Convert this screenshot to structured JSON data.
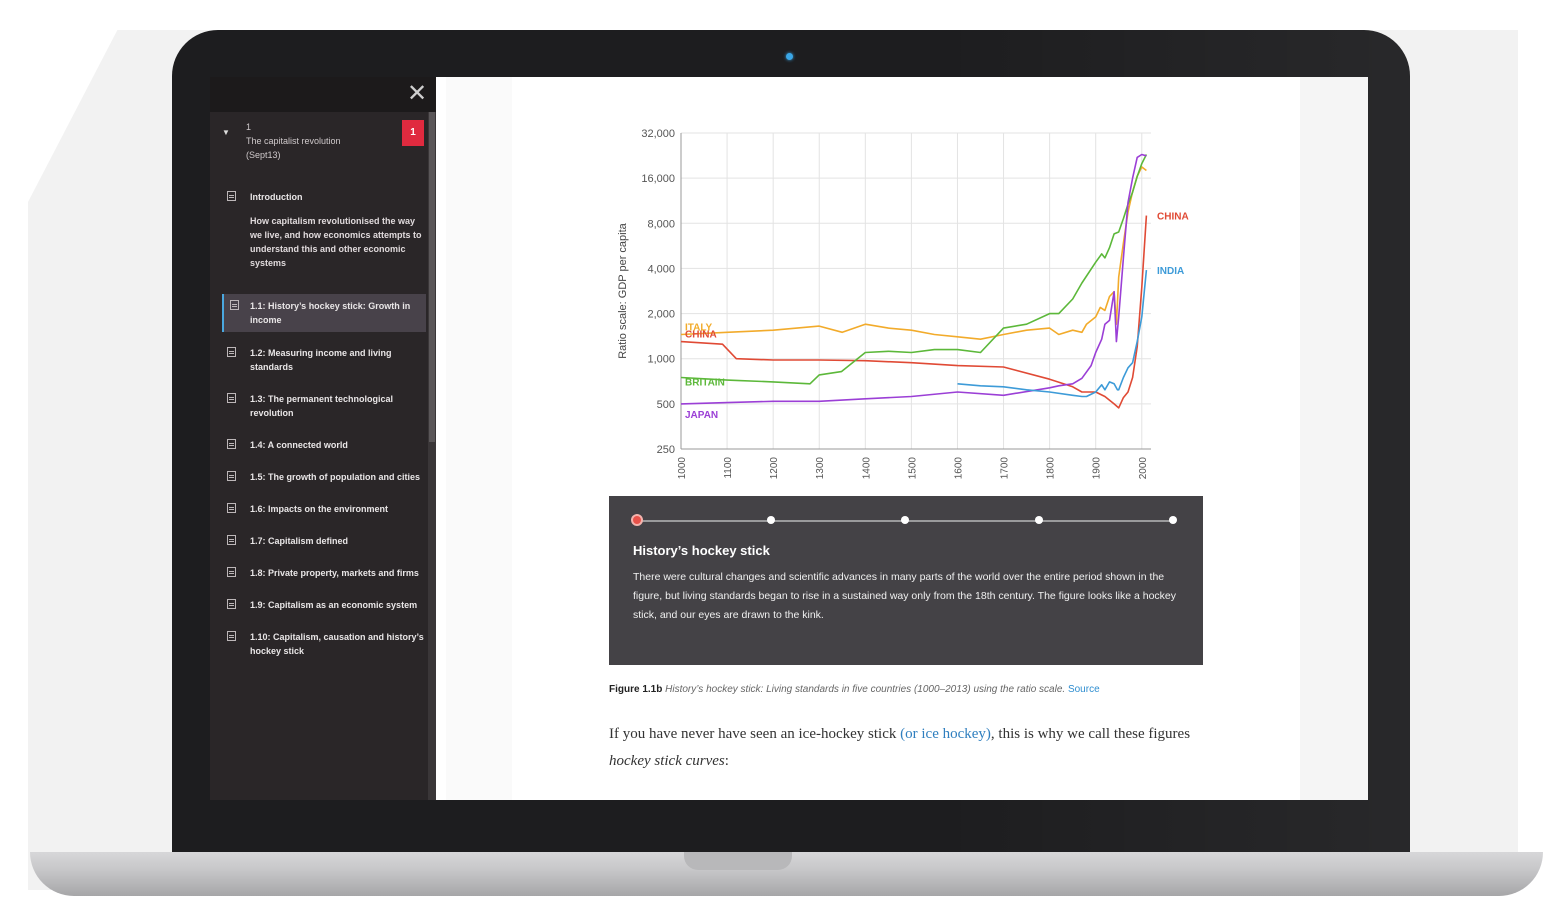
{
  "sidebar": {
    "chapter": {
      "number": "1",
      "title": "The capitalist revolution",
      "date": "(Sept13)",
      "badge": "1"
    },
    "intro_label": "Introduction",
    "intro_desc": "How capitalism revolutionised the way we live, and how economics attempts to understand this and other economic systems",
    "items": [
      {
        "label": "1.1: History’s hockey stick: Growth in income",
        "active": true
      },
      {
        "label": "1.2: Measuring income and living standards"
      },
      {
        "label": "1.3: The permanent technological revolution"
      },
      {
        "label": "1.4: A connected world"
      },
      {
        "label": "1.5: The growth of population and cities"
      },
      {
        "label": "1.6: Impacts on the environment"
      },
      {
        "label": "1.7: Capitalism defined"
      },
      {
        "label": "1.8: Private property, markets and firms"
      },
      {
        "label": "1.9: Capitalism as an economic system"
      },
      {
        "label": "1.10: Capitalism, causation and history’s hockey stick"
      }
    ]
  },
  "chart_data": {
    "type": "line",
    "ylabel": "Ratio scale: GDP per capita",
    "xlabel": "",
    "yscale": "log2",
    "ylim": [
      250,
      32000
    ],
    "xlim": [
      1000,
      2020
    ],
    "yticks": [
      "32,000",
      "16,000",
      "8,000",
      "4,000",
      "2,000",
      "1,000",
      "500",
      "250"
    ],
    "ytick_values": [
      32000,
      16000,
      8000,
      4000,
      2000,
      1000,
      500,
      250
    ],
    "xticks": [
      "1000",
      "1100",
      "1200",
      "1300",
      "1400",
      "1500",
      "1600",
      "1700",
      "1800",
      "1900",
      "2000"
    ],
    "xtick_values": [
      1000,
      1100,
      1200,
      1300,
      1400,
      1500,
      1600,
      1700,
      1800,
      1900,
      2000
    ],
    "grid": true,
    "series": [
      {
        "name": "ITALY",
        "color": "#f2ab2b",
        "label_side": "left",
        "x": [
          1000,
          1100,
          1200,
          1300,
          1350,
          1400,
          1450,
          1500,
          1550,
          1600,
          1650,
          1700,
          1750,
          1800,
          1820,
          1850,
          1870,
          1880,
          1900,
          1910,
          1920,
          1930,
          1940,
          1945,
          1950,
          1960,
          1970,
          1980,
          1990,
          2000,
          2010
        ],
        "y": [
          1450,
          1500,
          1550,
          1650,
          1500,
          1700,
          1600,
          1550,
          1450,
          1400,
          1350,
          1450,
          1550,
          1600,
          1450,
          1550,
          1500,
          1700,
          1900,
          2200,
          2100,
          2600,
          2800,
          1700,
          3500,
          5900,
          9500,
          13000,
          16500,
          19000,
          18000
        ]
      },
      {
        "name": "CHINA",
        "color": "#e04a35",
        "label_side": "both",
        "x": [
          1000,
          1090,
          1120,
          1200,
          1300,
          1400,
          1500,
          1600,
          1700,
          1800,
          1850,
          1870,
          1900,
          1920,
          1940,
          1950,
          1960,
          1970,
          1980,
          1990,
          2000,
          2010
        ],
        "y": [
          1300,
          1250,
          1000,
          980,
          980,
          970,
          940,
          900,
          880,
          730,
          650,
          600,
          600,
          560,
          500,
          470,
          550,
          600,
          750,
          1200,
          3000,
          9000
        ]
      },
      {
        "name": "BRITAIN",
        "color": "#5cb83a",
        "label_side": "left",
        "x": [
          1000,
          1100,
          1200,
          1280,
          1300,
          1348,
          1400,
          1450,
          1500,
          1550,
          1600,
          1650,
          1700,
          1750,
          1800,
          1820,
          1850,
          1870,
          1900,
          1913,
          1920,
          1930,
          1940,
          1950,
          1960,
          1970,
          1980,
          1990,
          2000,
          2010
        ],
        "y": [
          750,
          720,
          700,
          680,
          780,
          820,
          1100,
          1120,
          1100,
          1150,
          1150,
          1100,
          1600,
          1700,
          2000,
          2000,
          2500,
          3200,
          4400,
          5000,
          4700,
          5500,
          6800,
          7000,
          8600,
          10700,
          12900,
          16400,
          20000,
          23000
        ]
      },
      {
        "name": "JAPAN",
        "color": "#9b3fd6",
        "label_side": "left",
        "x": [
          1000,
          1100,
          1200,
          1300,
          1400,
          1500,
          1600,
          1700,
          1800,
          1820,
          1850,
          1870,
          1890,
          1900,
          1913,
          1920,
          1930,
          1940,
          1945,
          1950,
          1960,
          1970,
          1980,
          1990,
          2000,
          2010
        ],
        "y": [
          500,
          510,
          520,
          520,
          540,
          560,
          600,
          570,
          640,
          660,
          680,
          740,
          900,
          1100,
          1350,
          1700,
          1800,
          2800,
          1300,
          1900,
          4700,
          11000,
          16000,
          22000,
          23000,
          22500
        ]
      },
      {
        "name": "INDIA",
        "color": "#3d9bd8",
        "label_side": "right",
        "x": [
          1600,
          1650,
          1700,
          1750,
          1800,
          1850,
          1870,
          1880,
          1900,
          1913,
          1920,
          1930,
          1940,
          1947,
          1950,
          1960,
          1970,
          1980,
          1990,
          2000,
          2010
        ],
        "y": [
          680,
          660,
          650,
          620,
          600,
          570,
          560,
          560,
          600,
          670,
          620,
          700,
          680,
          620,
          620,
          750,
          870,
          940,
          1300,
          1900,
          3900
        ]
      }
    ]
  },
  "panel": {
    "title": "History’s hockey stick",
    "text": "There were cultural changes and scientific advances in many parts of the world over the entire period shown in the figure, but living standards began to rise in a sustained way only from the 18th century. The figure looks like a hockey stick, and our eyes are drawn to the kink.",
    "steps": 5,
    "active_step": 1
  },
  "caption": {
    "label": "Figure 1.1b",
    "text": "History’s hockey stick: Living standards in five countries (1000–2013) using the ratio scale.",
    "source": "Source"
  },
  "body": {
    "before": "If you have never have seen an ice-hockey stick ",
    "link": "(or ice hockey)",
    "middle": ", this is why we call these figures ",
    "emph": "hockey stick curves",
    "after": ":"
  }
}
